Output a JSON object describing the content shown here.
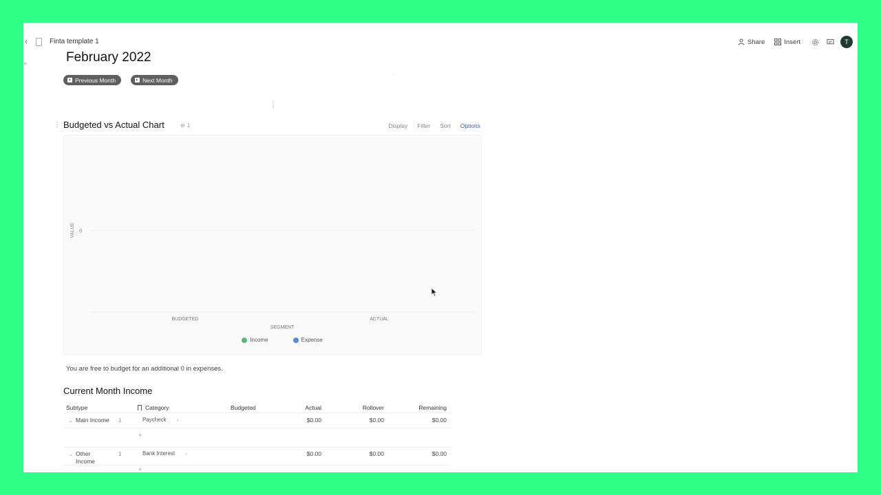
{
  "topbar": {
    "doc_title": "Finta template 1",
    "share_label": "Share",
    "insert_label": "Insert",
    "avatar_initial": "T"
  },
  "page": {
    "title": "February 2022",
    "prev_month_label": "Previous Month",
    "next_month_label": "Next Month"
  },
  "chart_section": {
    "title": "Budgeted vs Actual Chart",
    "link_count": "1",
    "actions": {
      "display": "Display",
      "filter": "Filter",
      "sort": "Sort",
      "options": "Options"
    }
  },
  "chart_data": {
    "type": "bar",
    "categories": [
      "BUDGETED",
      "ACTUAL"
    ],
    "series": [
      {
        "name": "Income",
        "values": [
          0,
          0
        ],
        "color": "#5cb87a"
      },
      {
        "name": "Expense",
        "values": [
          0,
          0
        ],
        "color": "#5b8ad6"
      }
    ],
    "xlabel": "SEGMENT",
    "ylabel": "VALUE",
    "y_ticks": [
      "0"
    ],
    "legend": "bottom",
    "grid": true
  },
  "budget_note": "You are free to budget for an additional 0 in expenses.",
  "income_section": {
    "title": "Current Month Income",
    "columns": {
      "subtype": "Subtype",
      "category": "Category",
      "budgeted": "Budgeted",
      "actual": "Actual",
      "rollover": "Rollover",
      "remaining": "Remaining"
    },
    "rows": [
      {
        "subtype": "Main Income",
        "count": "1",
        "category": "Paycheck",
        "budgeted": "",
        "actual": "$0.00",
        "rollover": "$0.00",
        "remaining": "$0.00",
        "add": "+"
      },
      {
        "subtype": "Other Income",
        "count": "1",
        "category": "Bank Interest",
        "budgeted": "",
        "actual": "$0.00",
        "rollover": "$0.00",
        "remaining": "$0.00",
        "add": "+"
      }
    ]
  }
}
